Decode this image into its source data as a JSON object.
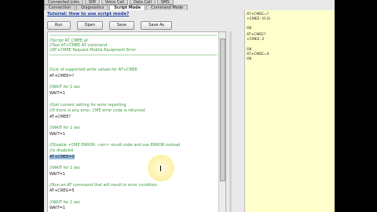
{
  "top_tabs": [
    {
      "label": "Connected Lists"
    },
    {
      "label": "SIM"
    },
    {
      "label": "Voice Call"
    },
    {
      "label": "Data Call"
    },
    {
      "label": "SMS"
    }
  ],
  "tabs": [
    {
      "label": "Connection",
      "active": false
    },
    {
      "label": "Diagnostics",
      "active": false
    },
    {
      "label": "Script Mode",
      "active": true
    },
    {
      "label": "Command Mode",
      "active": false
    }
  ],
  "tutorial_link": "Tutorial: How to use script mode?",
  "buttons": {
    "run": "Run",
    "open": "Open",
    "save": "Save",
    "save_as": "Save As"
  },
  "script_lines": [
    "//Script AT_CMEE.at",
    "//Test AT+CMEE AT command",
    "//AT+CMEE Request Mobile Equipment Error",
    "//List of supported write values for AT+CMEE",
    "AT+CMEE=?",
    "//WAIT for 1 sec",
    "WAIT=1",
    "//Get current setting for error reporting",
    "//If there is any error, CME error code is returned",
    "AT+CMEE?",
    "//WAIT for 1 sec",
    "WAIT=1",
    "//Disable +CME ERROR: <err> result code and use ERROR instead",
    "//is disabled",
    "AT+CMEE=0",
    "//WAIT for 1 sec",
    "WAIT=1",
    "//Run an AT command that will result in error condition",
    "AT+CREG=5",
    "//WAIT for 1 sec",
    "WAIT=1"
  ],
  "response_lines": [
    "AT+CMEE=?",
    "+CMEE: (0-2)",
    "OK",
    "AT+CMEE?",
    "+CMEE: 2",
    "OK",
    "AT+CMEE=0",
    "OK"
  ]
}
